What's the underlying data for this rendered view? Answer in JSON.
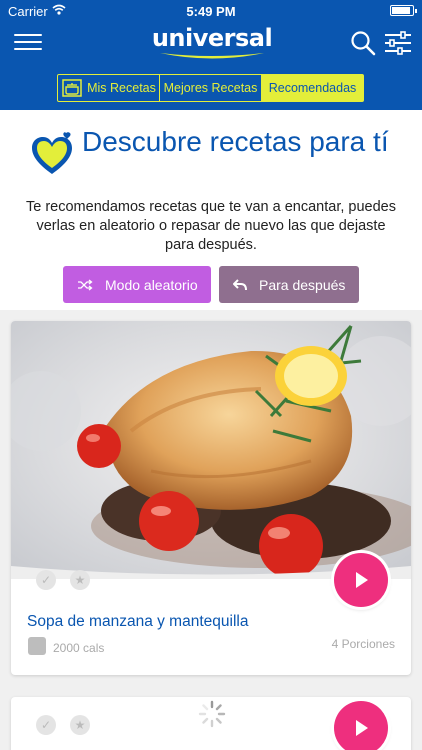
{
  "status_bar": {
    "carrier": "Carrier",
    "time": "5:49 PM"
  },
  "header": {
    "logo_text": "universal",
    "tabs": [
      {
        "label": "Mis Recetas",
        "icon": "pot-icon",
        "active": false
      },
      {
        "label": "Mejores Recetas",
        "active": false
      },
      {
        "label": "Recomendadas",
        "active": true
      }
    ]
  },
  "hero": {
    "title": "Descubre recetas para tí",
    "description": "Te recomendamos recetas que te van a encantar, puedes verlas en aleatorio o repasar de nuevo las que dejaste para después.",
    "random_button": "Modo aleatorio",
    "later_button": "Para después"
  },
  "recipes": [
    {
      "name": "Sopa de manzana y mantequilla",
      "calories": "2000 cals",
      "portions": "4 Porciones"
    }
  ],
  "colors": {
    "primary_blue": "#0a56b0",
    "accent_yellow": "#e3ee3a",
    "random_purple": "#c15de1",
    "later_mauve": "#8f6f8f",
    "play_pink": "#ee2f7e"
  }
}
